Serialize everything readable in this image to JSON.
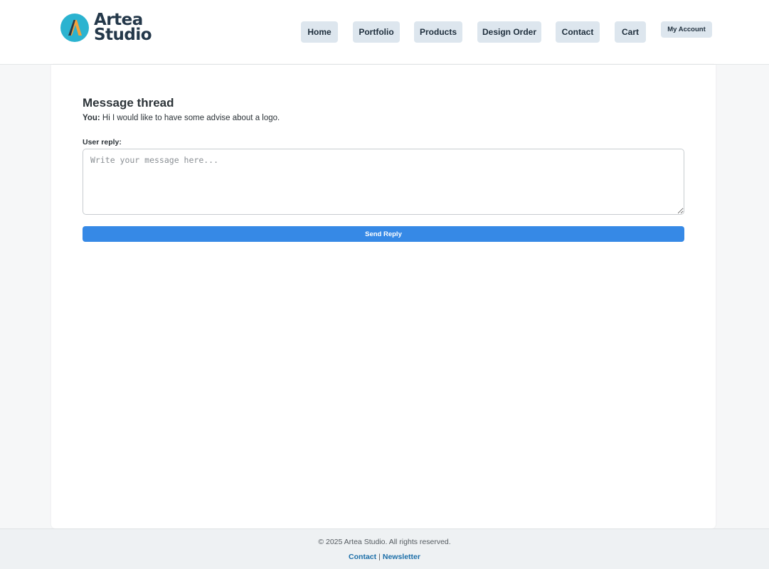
{
  "brand": {
    "line1": "Artea",
    "line2": "Studio",
    "icon": "logo-a-icon",
    "colors": {
      "circle": "#2bb3d0",
      "letter": "#f5a23a",
      "text": "#24384a"
    }
  },
  "nav": {
    "home": "Home",
    "portfolio": "Portfolio",
    "products": "Products",
    "design_order": "Design Order",
    "contact": "Contact",
    "cart": "Cart",
    "my_account": "My Account"
  },
  "thread": {
    "title": "Message thread",
    "message_author": "You:",
    "message_text": "Hi I would like to have some advise about a logo."
  },
  "reply": {
    "label": "User reply:",
    "placeholder": "Write your message here...",
    "value": "",
    "send_label": "Send Reply"
  },
  "footer": {
    "copyright": "© 2025 Artea Studio. All rights reserved.",
    "contact_link": "Contact",
    "separator": "|",
    "newsletter_link": "Newsletter"
  },
  "colors": {
    "accent": "#3689e6",
    "nav_bg": "#dde6ee",
    "link": "#1b6ea8"
  }
}
